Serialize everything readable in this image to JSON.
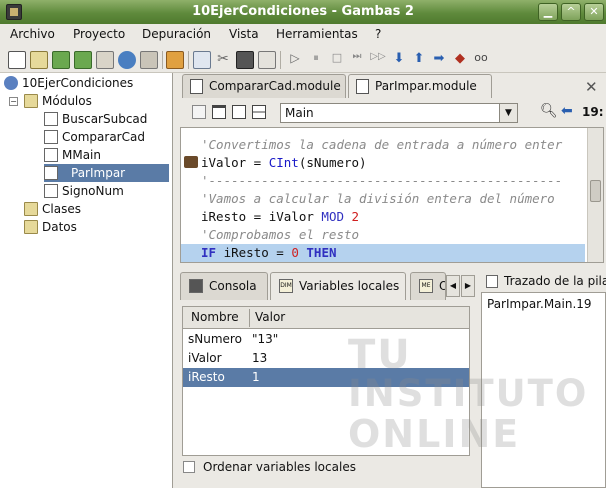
{
  "window": {
    "title": "10EjerCondiciones - Gambas 2"
  },
  "menu": [
    "Archivo",
    "Proyecto",
    "Depuración",
    "Vista",
    "Herramientas",
    "?"
  ],
  "tree": {
    "root": "10EjerCondiciones",
    "modules_label": "Módulos",
    "modules": [
      "BuscarSubcad",
      "CompararCad",
      "MMain",
      "ParImpar",
      "SignoNum"
    ],
    "selected": "ParImpar",
    "classes_label": "Clases",
    "data_label": "Datos"
  },
  "editor_tabs": [
    "CompararCad.module",
    "ParImpar.module"
  ],
  "editor": {
    "procedure": "Main",
    "line_number": "19:",
    "lines": [
      "'Convertimos la cadena de entrada a número enter",
      "iValor = CInt(sNumero)",
      "'-----------------------------------------------",
      "'Vamos a calcular la división entera del número",
      "iResto = iValor MOD 2",
      "'Comprobamos el resto",
      "IF iResto = 0 THEN"
    ]
  },
  "bottom_tabs": [
    "Consola",
    "Variables locales",
    "O"
  ],
  "variables": {
    "headers": [
      "Nombre",
      "Valor"
    ],
    "rows": [
      {
        "name": "sNumero",
        "value": "\"13\""
      },
      {
        "name": "iValor",
        "value": "13"
      },
      {
        "name": "iResto",
        "value": "1"
      }
    ],
    "selected_row": 2,
    "checkbox_label": "Ordenar variables locales"
  },
  "stack": {
    "title": "Trazado de la pila",
    "items": [
      "ParImpar.Main.19"
    ]
  },
  "watermark": [
    "TU",
    "INSTITUTO",
    "ONLINE"
  ],
  "colors": {
    "titlebar": "#5f8a3c",
    "selection": "#5a7ba6",
    "current_line": "#b5d2ee"
  }
}
